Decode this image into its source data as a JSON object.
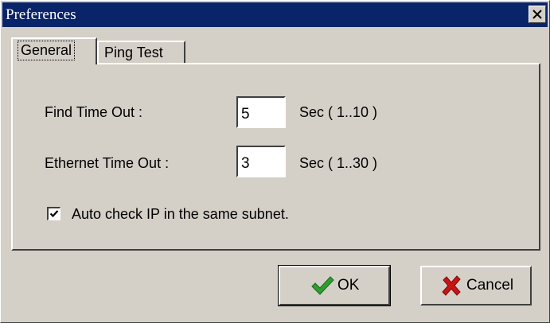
{
  "window": {
    "title": "Preferences"
  },
  "tabs": [
    {
      "label": "General",
      "active": true
    },
    {
      "label": "Ping Test",
      "active": false
    }
  ],
  "general": {
    "find_timeout_label": "Find Time Out :",
    "find_timeout_value": "5",
    "find_timeout_range": "Sec ( 1..10 )",
    "ethernet_timeout_label": "Ethernet Time Out :",
    "ethernet_timeout_value": "3",
    "ethernet_timeout_range": "Sec ( 1..30 )",
    "auto_check_label": "Auto check IP in the same subnet.",
    "auto_check_checked": true
  },
  "buttons": {
    "ok_label": "OK",
    "cancel_label": "Cancel"
  },
  "colors": {
    "titlebar": "#0a246a",
    "face": "#d4d0c8",
    "ok_icon": "#2e9e2e",
    "cancel_icon": "#c81414"
  },
  "icons": {
    "close": "close-icon",
    "ok": "checkmark-icon",
    "cancel": "x-mark-icon",
    "checkbox": "checkbox-check-icon"
  }
}
